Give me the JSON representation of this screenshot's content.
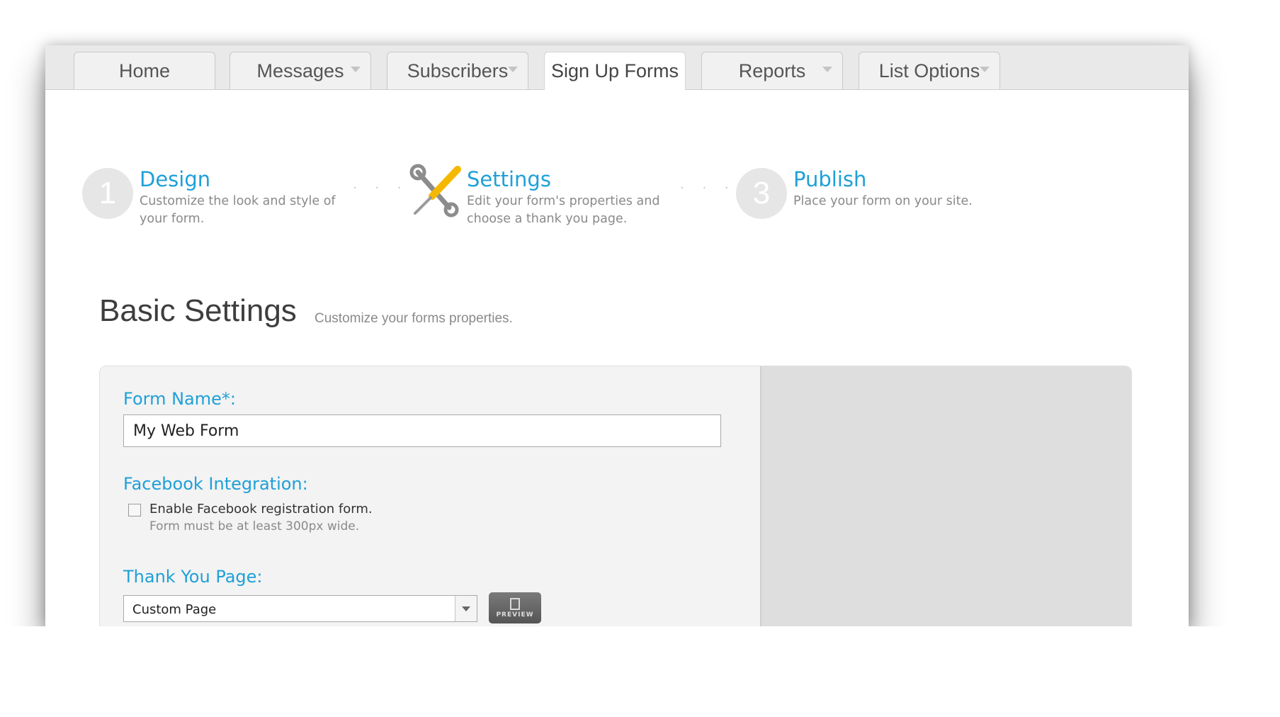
{
  "tabs": [
    {
      "label": "Home",
      "dropdown": false,
      "active": false
    },
    {
      "label": "Messages",
      "dropdown": true,
      "active": false
    },
    {
      "label": "Subscribers",
      "dropdown": true,
      "active": false
    },
    {
      "label": "Sign Up Forms",
      "dropdown": false,
      "active": true
    },
    {
      "label": "Reports",
      "dropdown": true,
      "active": false
    },
    {
      "label": "List Options",
      "dropdown": true,
      "active": false
    }
  ],
  "steps": [
    {
      "number": "1",
      "title": "Design",
      "description": "Customize the look and style of your form.",
      "state": "inactive"
    },
    {
      "number": "",
      "title": "Settings",
      "description": "Edit your form's properties and choose a thank you page.",
      "state": "current",
      "icon": "tools-icon"
    },
    {
      "number": "3",
      "title": "Publish",
      "description": "Place your form on your site.",
      "state": "inactive"
    }
  ],
  "step_separator": ". . .",
  "section": {
    "title": "Basic Settings",
    "subtitle": "Customize your forms properties."
  },
  "form": {
    "form_name_label": "Form Name*:",
    "form_name_value": "My Web Form",
    "facebook_label": "Facebook Integration:",
    "facebook_checkbox_label": "Enable Facebook registration form.",
    "facebook_checked": false,
    "facebook_hint": "Form must be at least 300px wide.",
    "thank_you_label": "Thank You Page:",
    "thank_you_value": "Custom Page",
    "preview_label": "PREVIEW"
  },
  "colors": {
    "accent": "#1fa0d8",
    "tool_handle": "#f5b800",
    "step_circle": "#e6e6e6"
  }
}
